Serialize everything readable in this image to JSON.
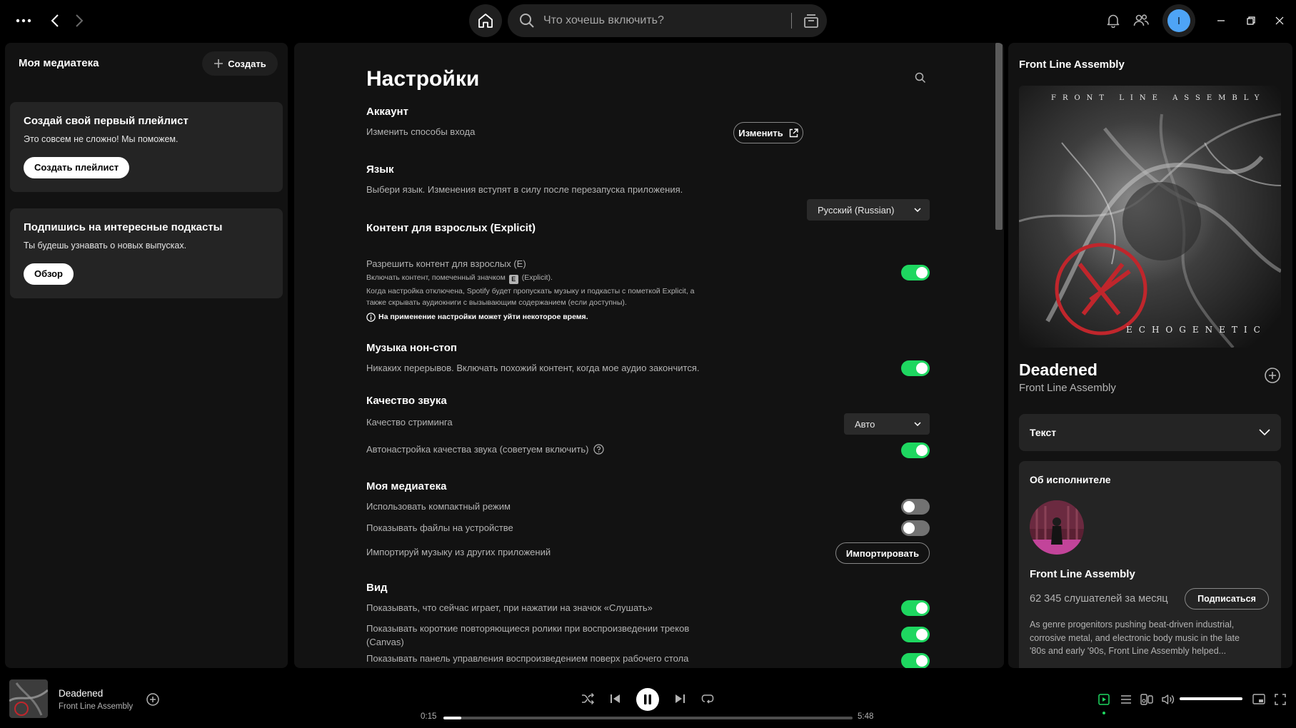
{
  "topbar": {
    "search_placeholder": "Что хочешь включить?",
    "avatar_initial": "I"
  },
  "library": {
    "title": "Моя медиатека",
    "create_label": "Создать",
    "cards": [
      {
        "title": "Создай свой первый плейлист",
        "text": "Это совсем не сложно! Мы поможем.",
        "button": "Создать плейлист"
      },
      {
        "title": "Подпишись на интересные подкасты",
        "text": "Ты будешь узнавать о новых выпусках.",
        "button": "Обзор"
      }
    ]
  },
  "settings": {
    "title": "Настройки",
    "account": {
      "heading": "Аккаунт",
      "label": "Изменить способы входа",
      "button": "Изменить"
    },
    "language": {
      "heading": "Язык",
      "label": "Выбери язык. Изменения вступят в силу после перезапуска приложения.",
      "value": "Русский (Russian)"
    },
    "explicit": {
      "heading": "Контент для взрослых (Explicit)",
      "label": "Разрешить контент для взрослых (E)",
      "line1_a": "Включать контент, помеченный значком",
      "badge": "E",
      "line1_b": "(Explicit).",
      "line2": "Когда настройка отключена, Spotify будет пропускать музыку и подкасты с пометкой Explicit, а",
      "line3": "также скрывать аудиокниги с вызывающим содержанием (если доступны).",
      "note": "На применение настройки может уйти некоторое время.",
      "enabled": true
    },
    "autoplay": {
      "heading": "Музыка нон-стоп",
      "label": "Никаких перерывов. Включать похожий контент, когда мое аудио закончится.",
      "enabled": true
    },
    "audio": {
      "heading": "Качество звука",
      "streaming_label": "Качество стриминга",
      "streaming_value": "Авто",
      "auto_label": "Автонастройка качества звука (советуем включить)",
      "auto_enabled": true
    },
    "my_library": {
      "heading": "Моя медиатека",
      "compact_label": "Использовать компактный режим",
      "compact_enabled": false,
      "local_label": "Показывать файлы на устройстве",
      "local_enabled": false,
      "import_label": "Импортируй музыку из других приложений",
      "import_button": "Импортировать"
    },
    "display": {
      "heading": "Вид",
      "row1": "Показывать, что сейчас играет, при нажатии на значок «Слушать»",
      "row2a": "Показывать короткие повторяющиеся ролики при воспроизведении треков",
      "row2b": "(Canvas)",
      "row3": "Показывать панель управления воспроизведением поверх рабочего стола",
      "row1_enabled": true,
      "row2_enabled": true,
      "row3_enabled": true
    }
  },
  "now_playing_view": {
    "header": "Front Line Assembly",
    "cover_top": "FRONT LINE ASSEMBLY",
    "cover_bottom": "ECHOGENETIC",
    "song": "Deadened",
    "artist": "Front Line Assembly",
    "lyrics_label": "Текст",
    "about": {
      "heading": "Об исполнителе",
      "name": "Front Line Assembly",
      "listeners": "62 345 слушателей за месяц",
      "follow": "Подписаться",
      "desc1": "As genre progenitors pushing beat-driven industrial,",
      "desc2": "corrosive metal, and electronic body music in the late",
      "desc3": "'80s and early '90s, Front Line Assembly helped..."
    }
  },
  "player": {
    "song": "Deadened",
    "artist": "Front Line Assembly",
    "elapsed": "0:15",
    "duration": "5:48",
    "progress_fraction": 0.043,
    "volume_fraction": 1.0
  },
  "colors": {
    "accent": "#1ed760",
    "panel": "#121212",
    "card": "#242424"
  }
}
